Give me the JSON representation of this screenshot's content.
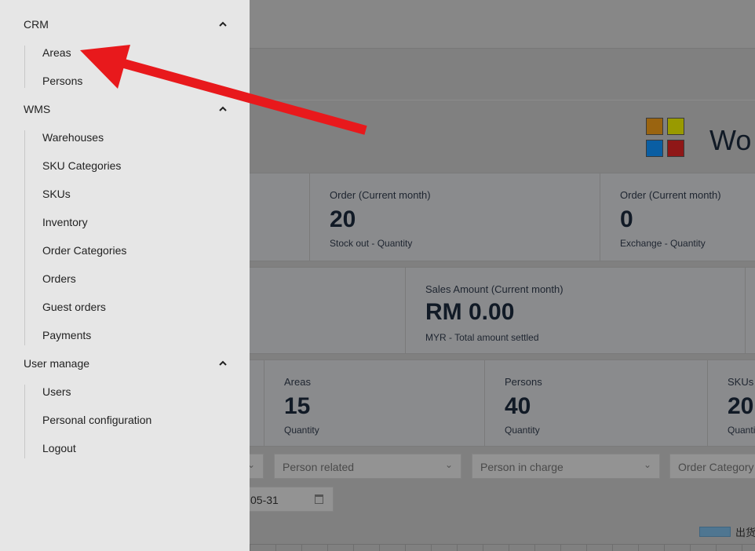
{
  "sidebar": {
    "sections": [
      {
        "label": "CRM",
        "items": [
          "Areas",
          "Persons"
        ]
      },
      {
        "label": "WMS",
        "items": [
          "Warehouses",
          "SKU Categories",
          "SKUs",
          "Inventory",
          "Order Categories",
          "Orders",
          "Guest orders",
          "Payments"
        ]
      },
      {
        "label": "User manage",
        "items": [
          "Users",
          "Personal configuration",
          "Logout"
        ]
      }
    ]
  },
  "header": {
    "title": "Wo"
  },
  "logo_colors": [
    "#9a6410",
    "#999a00",
    "#0a5ea3",
    "#8f1717"
  ],
  "cards_row1": [
    {
      "title": "Order (Current month)",
      "value": "20",
      "sub": "Stock out - Quantity"
    },
    {
      "title": "Order (Current month)",
      "value": "0",
      "sub": "Exchange - Quantity"
    }
  ],
  "cards_row2": [
    {
      "title": "Sales Amount (Current month)",
      "value": "RM 0.00",
      "sub": "MYR - Total amount settled"
    }
  ],
  "cards_row3": [
    {
      "title": "Areas",
      "value": "15",
      "sub": "Quantity"
    },
    {
      "title": "Persons",
      "value": "40",
      "sub": "Quantity"
    },
    {
      "title": "SKUs",
      "value": "20",
      "sub": "Quantity"
    }
  ],
  "filters": {
    "person_related": "Person related",
    "person_in_charge": "Person in charge",
    "order_category": "Order Category",
    "date_end": "05-31"
  },
  "legend": {
    "label": "出货"
  },
  "annotation": {
    "arrow_color": "#e8191c"
  }
}
